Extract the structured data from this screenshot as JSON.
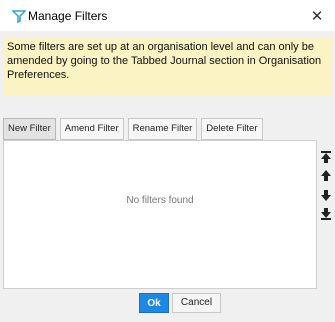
{
  "window": {
    "title": "Manage Filters",
    "close_glyph": "✕"
  },
  "info_message": "Some filters are set up at an organisation level and can only be amended by going to the Tabbed Journal section in Organisation Preferences.",
  "toolbar": {
    "new_filter": "New Filter",
    "amend_filter": "Amend Filter",
    "rename_filter": "Rename Filter",
    "delete_filter": "Delete Filter"
  },
  "list": {
    "empty_text": "No filters found"
  },
  "side_buttons": {
    "move_top_icon": "arrow-top-icon",
    "move_up_icon": "arrow-up-icon",
    "move_down_icon": "arrow-down-icon",
    "move_bottom_icon": "arrow-bottom-icon"
  },
  "dialog_buttons": {
    "ok": "Ok",
    "cancel": "Cancel"
  },
  "colors": {
    "info_bg": "#fbf3c4",
    "ok_bg": "#1e88e5",
    "title_icon": "#2aa3d8"
  }
}
